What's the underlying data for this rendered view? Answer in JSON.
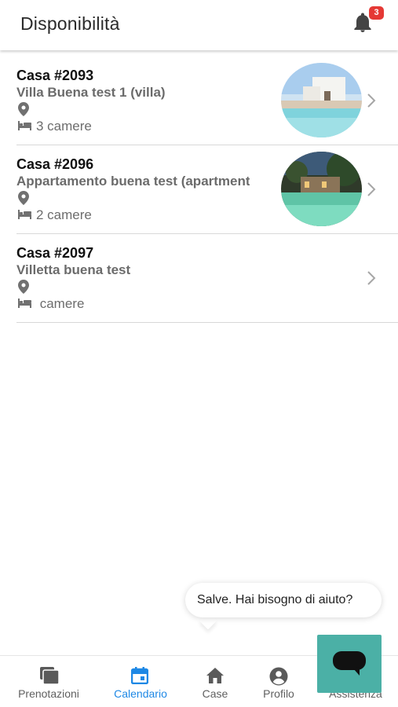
{
  "header": {
    "title": "Disponibilità",
    "notification_count": "3"
  },
  "listings": [
    {
      "ref": "Casa #2093",
      "name": "Villa Buena test 1  (villa)",
      "rooms": "3 camere",
      "has_photo": true
    },
    {
      "ref": "Casa #2096",
      "name": "Appartamento buena test  (apartment)",
      "rooms": "2 camere",
      "has_photo": true
    },
    {
      "ref": "Casa #2097",
      "name": "Villetta buena test",
      "rooms": " camere",
      "has_photo": false
    }
  ],
  "chat": {
    "greeting": "Salve. Hai bisogno di aiuto?"
  },
  "nav": {
    "items": [
      {
        "label": "Prenotazioni",
        "icon": "bookings-icon",
        "active": false
      },
      {
        "label": "Calendario",
        "icon": "calendar-icon",
        "active": true
      },
      {
        "label": "Case",
        "icon": "home-icon",
        "active": false
      },
      {
        "label": "Profilo",
        "icon": "account-icon",
        "active": false
      },
      {
        "label": "Assistenza",
        "icon": "support-icon",
        "active": false
      }
    ]
  },
  "colors": {
    "accent": "#1e88e5",
    "badge": "#e53935",
    "chat_button": "#4bb0a6"
  }
}
